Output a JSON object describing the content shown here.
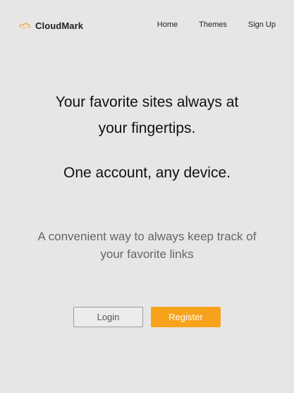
{
  "brand": {
    "name": "CloudMark",
    "logo_icon": "cloud-link-icon",
    "logo_color": "#f3b04a"
  },
  "nav": {
    "links": [
      {
        "label": "Home"
      },
      {
        "label": "Themes"
      },
      {
        "label": "Sign Up"
      }
    ]
  },
  "hero": {
    "headline_line1": "Your favorite sites always at",
    "headline_line2": "your fingertips.",
    "subheadline": "One account, any device.",
    "tagline_line1": "A convenient way to always keep track of",
    "tagline_line2": "your favorite links"
  },
  "actions": {
    "login_label": "Login",
    "register_label": "Register"
  },
  "colors": {
    "background": "#e6e6e6",
    "accent": "#f7a21b",
    "text": "#111111",
    "muted_text": "#666666"
  }
}
